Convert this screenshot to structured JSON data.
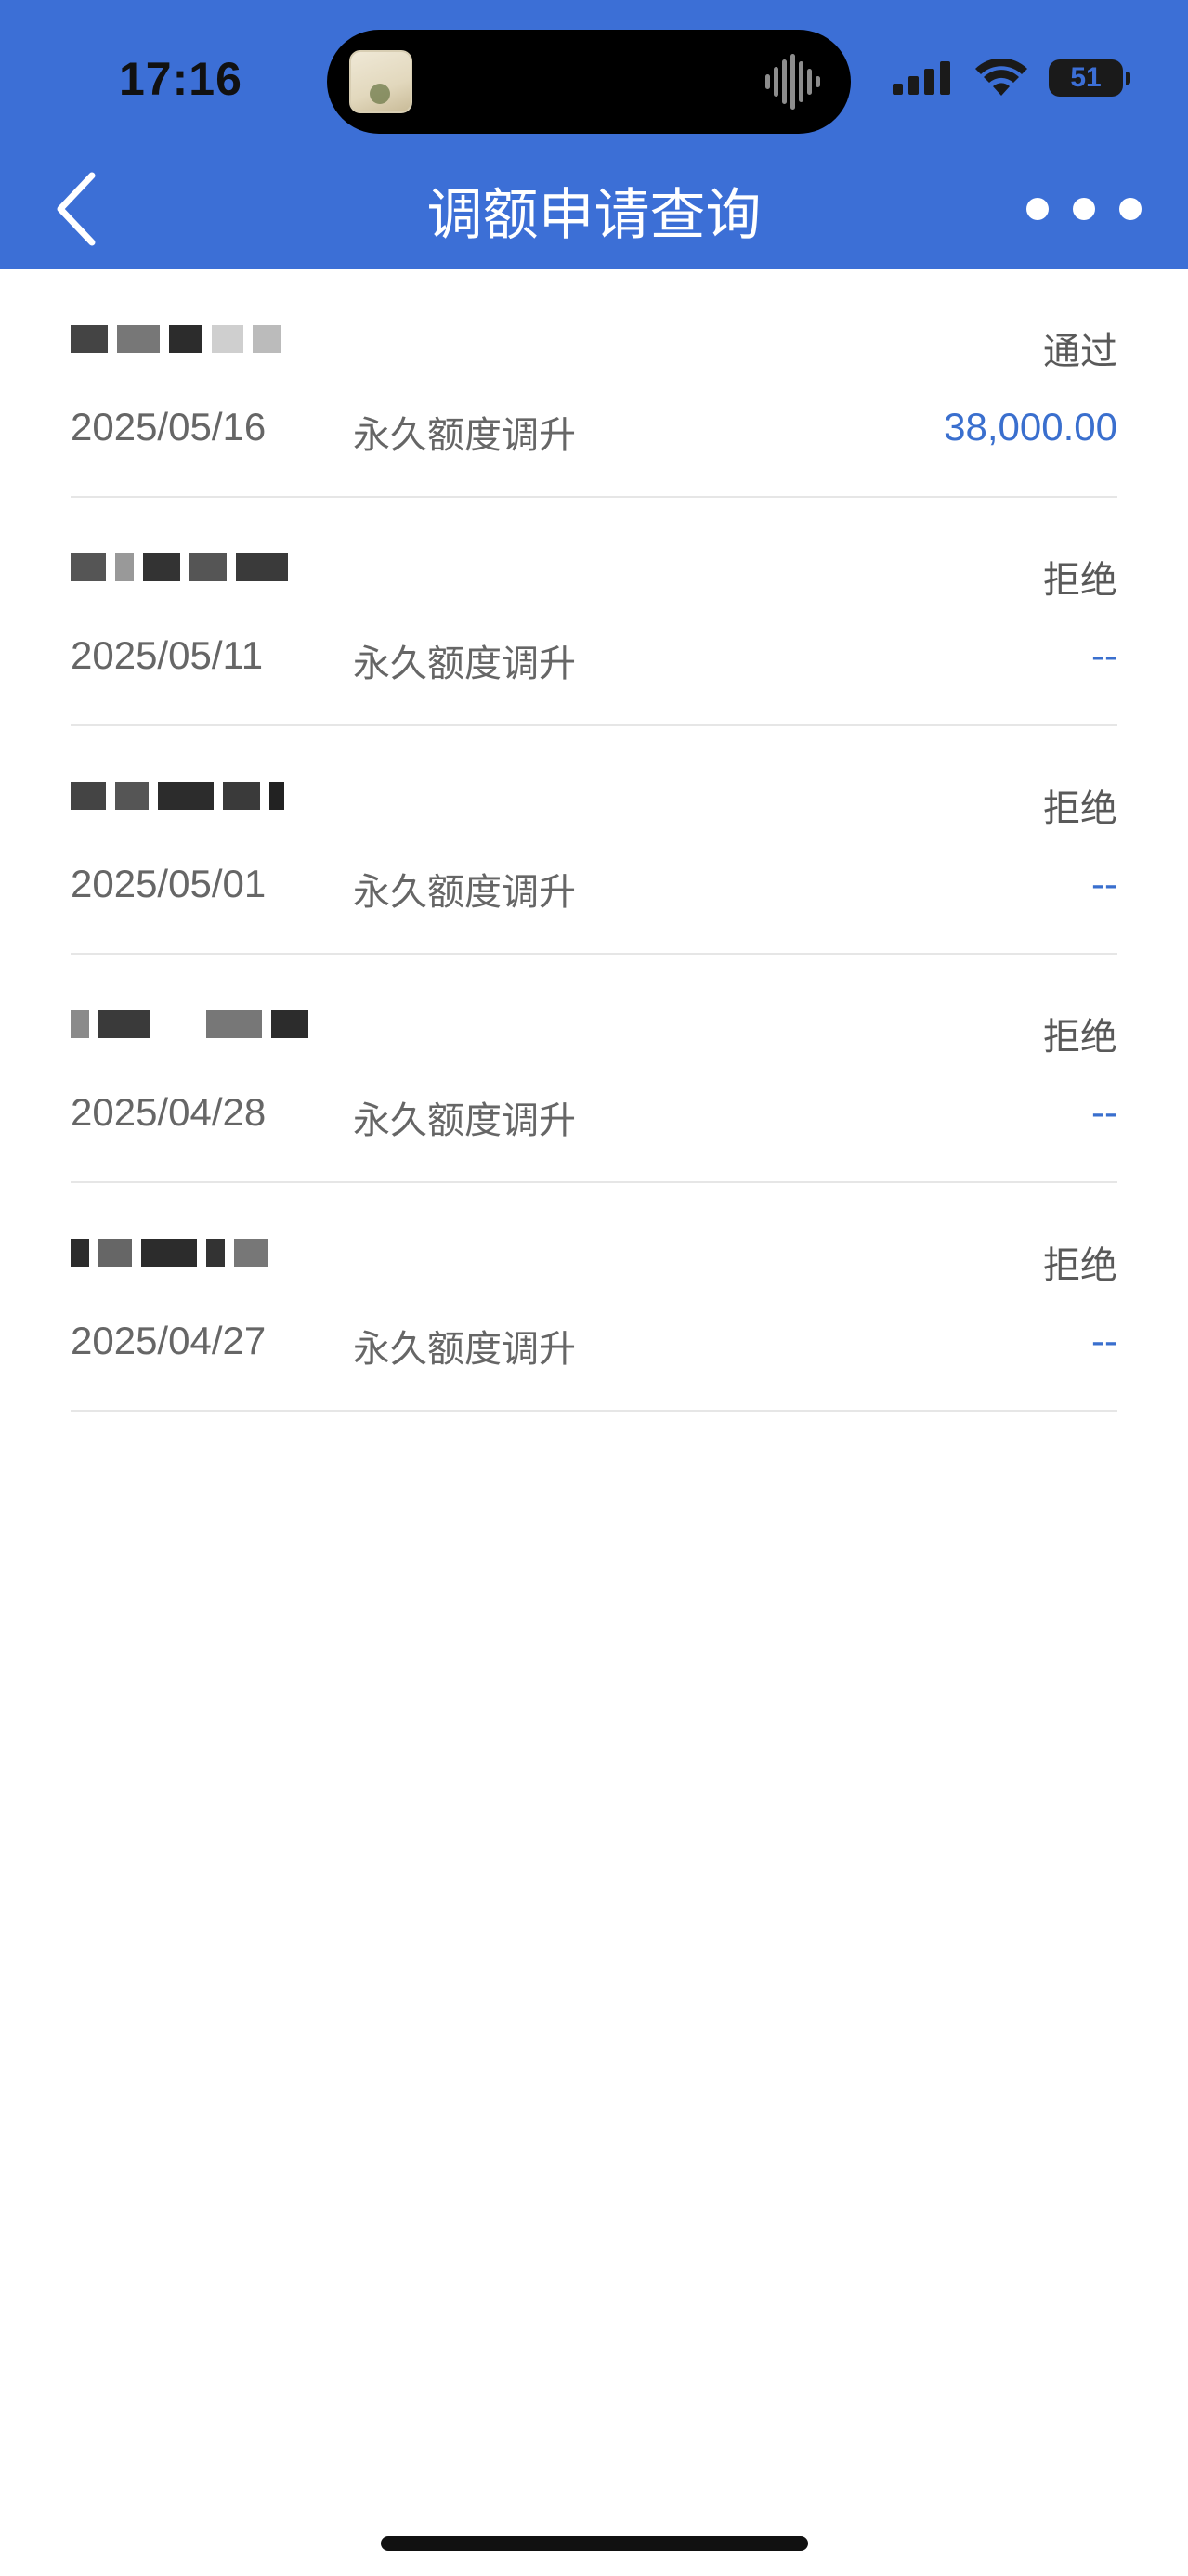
{
  "status_bar": {
    "time": "17:16",
    "battery": "51"
  },
  "nav": {
    "title": "调额申请查询",
    "back_icon": "chevron-left-icon",
    "more_icon": "ellipsis-icon"
  },
  "records": [
    {
      "date": "2025/05/16",
      "type": "永久额度调升",
      "status": "通过",
      "amount": "38,000.00"
    },
    {
      "date": "2025/05/11",
      "type": "永久额度调升",
      "status": "拒绝",
      "amount": "--"
    },
    {
      "date": "2025/05/01",
      "type": "永久额度调升",
      "status": "拒绝",
      "amount": "--"
    },
    {
      "date": "2025/04/28",
      "type": "永久额度调升",
      "status": "拒绝",
      "amount": "--"
    },
    {
      "date": "2025/04/27",
      "type": "永久额度调升",
      "status": "拒绝",
      "amount": "--"
    }
  ],
  "colors": {
    "header_bg": "#3c6fd6",
    "amount": "#3a6fce",
    "status_text": "#595959"
  }
}
